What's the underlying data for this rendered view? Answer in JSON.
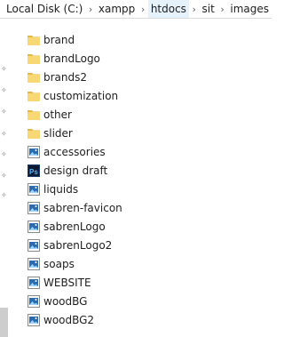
{
  "breadcrumb": {
    "items": [
      {
        "label": "Local Disk (C:)",
        "highlight": false
      },
      {
        "label": "xampp",
        "highlight": false
      },
      {
        "label": "htdocs",
        "highlight": true
      },
      {
        "label": "sit",
        "highlight": false
      },
      {
        "label": "images",
        "highlight": false
      }
    ],
    "separator": "›"
  },
  "files": [
    {
      "name": "brand",
      "type": "folder"
    },
    {
      "name": "brandLogo",
      "type": "folder"
    },
    {
      "name": "brands2",
      "type": "folder"
    },
    {
      "name": "customization",
      "type": "folder"
    },
    {
      "name": "other",
      "type": "folder"
    },
    {
      "name": "slider",
      "type": "folder"
    },
    {
      "name": "accessories",
      "type": "image"
    },
    {
      "name": "design draft",
      "type": "photoshop"
    },
    {
      "name": "liquids",
      "type": "image"
    },
    {
      "name": "sabren-favicon",
      "type": "image"
    },
    {
      "name": "sabrenLogo",
      "type": "image"
    },
    {
      "name": "sabrenLogo2",
      "type": "image"
    },
    {
      "name": "soaps",
      "type": "image"
    },
    {
      "name": "WEBSITE",
      "type": "image"
    },
    {
      "name": "woodBG",
      "type": "image"
    },
    {
      "name": "woodBG2",
      "type": "image"
    }
  ],
  "colors": {
    "folder": "#f8d775",
    "folder_dark": "#e2b944",
    "image_blue": "#2b6cb0",
    "photoshop": "#1e3a6d",
    "highlight": "#e5f1fb"
  }
}
